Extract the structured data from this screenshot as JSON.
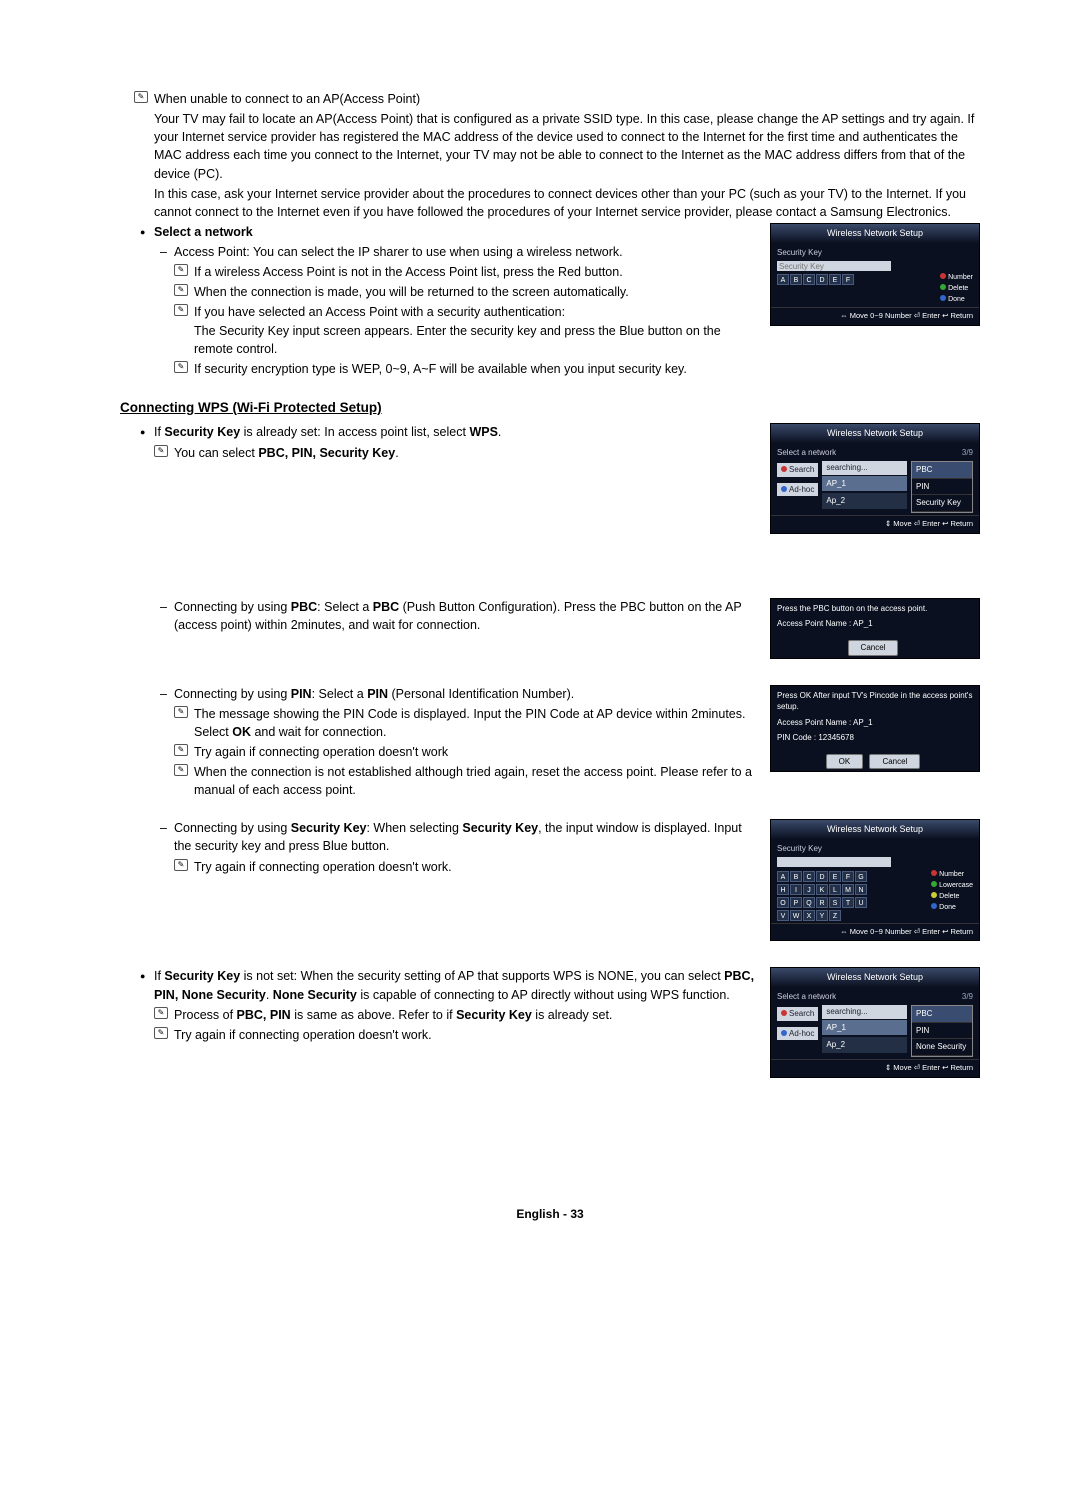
{
  "intro": {
    "note1": "When unable to connect to an AP(Access Point)",
    "para1": "Your TV may fail to locate an AP(Access Point) that is configured as a private SSID type. In this case, please change the AP settings and try again. If your Internet service provider has registered the MAC address of the device used to connect to the Internet for the first time and authenticates the MAC address each time you connect to the Internet, your TV may not be able to connect to the Internet as the MAC address differs from that of the device (PC).",
    "para2": "In this case, ask your Internet service provider about the procedures to connect devices other than your PC (such as your TV) to the Internet. If you cannot connect to the Internet even if you have followed the procedures of your Internet service provider, please contact a Samsung Electronics."
  },
  "select_network": {
    "title": "Select a network",
    "dash1": "Access Point: You can select the IP sharer to use when using a wireless network.",
    "n1": "If a wireless Access Point is not in the Access Point list, press the Red button.",
    "n2": "When the connection is made, you will be returned to the screen automatically.",
    "n3": "If you have selected an Access Point with a security authentication:",
    "n3b": "The Security Key input screen appears. Enter the security key and press the Blue button on the remote control.",
    "n4": "If security encryption type is WEP, 0~9, A~F will be available when you input security key."
  },
  "wps": {
    "heading": "Connecting WPS (Wi-Fi Protected Setup)",
    "bullet1a": "If ",
    "bullet1b": "Security Key",
    "bullet1c": " is already set: In access point list, select ",
    "bullet1d": "WPS",
    "bullet1e": ".",
    "n1a": "You can select ",
    "n1b": "PBC, PIN, Security Key",
    "n1c": ".",
    "pbc_a": "Connecting by using ",
    "pbc_b": "PBC",
    "pbc_c": ": Select a ",
    "pbc_d": "PBC",
    "pbc_e": " (Push Button Configuration). Press the PBC button on the AP (access point) within 2minutes, and wait for connection.",
    "pin_a": "Connecting by using ",
    "pin_b": "PIN",
    "pin_c": ": Select a ",
    "pin_d": "PIN",
    "pin_e": " (Personal Identification Number).",
    "pin_n1a": "The message showing the PIN Code is displayed. Input the PIN Code at AP device within 2minutes. Select ",
    "pin_n1b": "OK",
    "pin_n1c": " and wait for connection.",
    "pin_n2": "Try again if connecting operation doesn't work",
    "pin_n3": "When the connection is not established although tried again, reset the access point. Please refer to a manual of each access point.",
    "sk_a": "Connecting by using ",
    "sk_b": "Security Key",
    "sk_c": ": When selecting ",
    "sk_d": "Security Key",
    "sk_e": ", the input window is displayed. Input the security key and press Blue button.",
    "sk_n1": "Try again if connecting operation doesn't work.",
    "ns_a": "If ",
    "ns_b": "Security Key",
    "ns_c": " is not set: When the security setting of AP that supports WPS is NONE, you can select ",
    "ns_d": "PBC, PIN, None Security",
    "ns_e": ". ",
    "ns_f": "None Security",
    "ns_g": " is capable of connecting to AP directly without using WPS function.",
    "ns_n1a": "Process of ",
    "ns_n1b": "PBC, PIN",
    "ns_n1c": " is same as above. Refer to if ",
    "ns_n1d": "Security Key",
    "ns_n1e": " is already set.",
    "ns_n2": "Try again if connecting operation doesn't work."
  },
  "panel1": {
    "title": "Wireless Network Setup",
    "label": "Security Key",
    "keys": [
      "A",
      "B",
      "C",
      "D",
      "E",
      "F"
    ],
    "side": [
      "Number",
      "Delete",
      "Done"
    ],
    "footer": "⇔ Move   0~9 Number   ⏎ Enter   ↩ Return"
  },
  "panel2": {
    "title": "Wireless Network Setup",
    "label": "Select a network",
    "count": "3/9",
    "items_pre": "searching...",
    "items": [
      "AP_1",
      "Ap_2"
    ],
    "side_btns": [
      "Search",
      "Ad-hoc"
    ],
    "options": [
      "PBC",
      "PIN",
      "Security Key"
    ],
    "footer": "⇕ Move   ⏎ Enter   ↩ Return"
  },
  "panel3": {
    "msg": "Press the PBC button on the access point.",
    "ap": "Access Point Name : AP_1",
    "cancel": "Cancel"
  },
  "panel4": {
    "msg": "Press OK After input TV's Pincode in the access point's setup.",
    "ap": "Access Point Name : AP_1",
    "pin": "PIN Code : 12345678",
    "ok": "OK",
    "cancel": "Cancel"
  },
  "panel5": {
    "title": "Wireless Network Setup",
    "label": "Security Key",
    "rows": [
      [
        "A",
        "B",
        "C",
        "D",
        "E",
        "F",
        "G"
      ],
      [
        "H",
        "I",
        "J",
        "K",
        "L",
        "M",
        "N"
      ],
      [
        "O",
        "P",
        "Q",
        "R",
        "S",
        "T",
        "U"
      ],
      [
        "V",
        "W",
        "X",
        "Y",
        "Z",
        "",
        ""
      ]
    ],
    "side": [
      "Number",
      "Lowercase",
      "Delete",
      "Done"
    ],
    "footer": "⇔ Move   0~9 Number   ⏎ Enter   ↩ Return"
  },
  "panel6": {
    "title": "Wireless Network Setup",
    "label": "Select a network",
    "count": "3/9",
    "items_pre": "searching...",
    "items": [
      "AP_1",
      "Ap_2"
    ],
    "side_btns": [
      "Search",
      "Ad-hoc"
    ],
    "options": [
      "PBC",
      "PIN",
      "None Security"
    ],
    "footer": "⇕ Move   ⏎ Enter   ↩ Return"
  },
  "footer": "English - 33"
}
